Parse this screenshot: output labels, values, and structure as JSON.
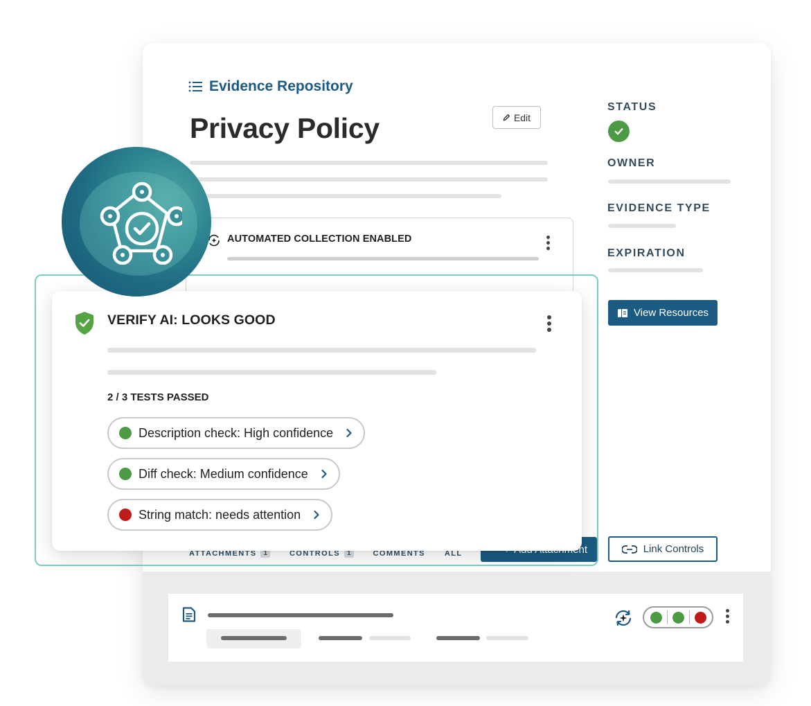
{
  "colors": {
    "brand": "#1b5a82",
    "success": "#4c9a43",
    "danger": "#c11a1a",
    "teal_accent": "#7ccbc1",
    "shield_green": "#56a344"
  },
  "breadcrumb": {
    "icon": "list-icon",
    "label": "Evidence Repository"
  },
  "page": {
    "title": "Privacy Policy",
    "edit_label": "Edit"
  },
  "sidebar": {
    "status_label": "STATUS",
    "owner_label": "OWNER",
    "evidence_type_label": "EVIDENCE TYPE",
    "expiration_label": "EXPIRATION",
    "view_resources_label": "View Resources",
    "link_controls_label": "Link Controls"
  },
  "automation": {
    "title": "AUTOMATED COLLECTION ENABLED"
  },
  "verify": {
    "title": "VERIFY AI: LOOKS GOOD",
    "tests_summary": "2 / 3 TESTS PASSED",
    "checks": [
      {
        "label": "Description check: High confidence",
        "status": "pass",
        "color": "#4c9a43"
      },
      {
        "label": "Diff check: Medium confidence",
        "status": "pass",
        "color": "#4c9a43"
      },
      {
        "label": "String match: needs attention",
        "status": "fail",
        "color": "#c11a1a"
      }
    ]
  },
  "tabs": [
    {
      "label": "ATTACHMENTS",
      "count": "1"
    },
    {
      "label": "CONTROLS",
      "count": "1"
    },
    {
      "label": "COMMENTS"
    },
    {
      "label": "ALL"
    }
  ],
  "add_attachment_label": "Add Attachment",
  "file_row": {
    "icon": "document-icon",
    "sync_icon": "sync-sparkle-icon",
    "status_dots": [
      "#4c9a43",
      "#4c9a43",
      "#c11a1a"
    ]
  }
}
